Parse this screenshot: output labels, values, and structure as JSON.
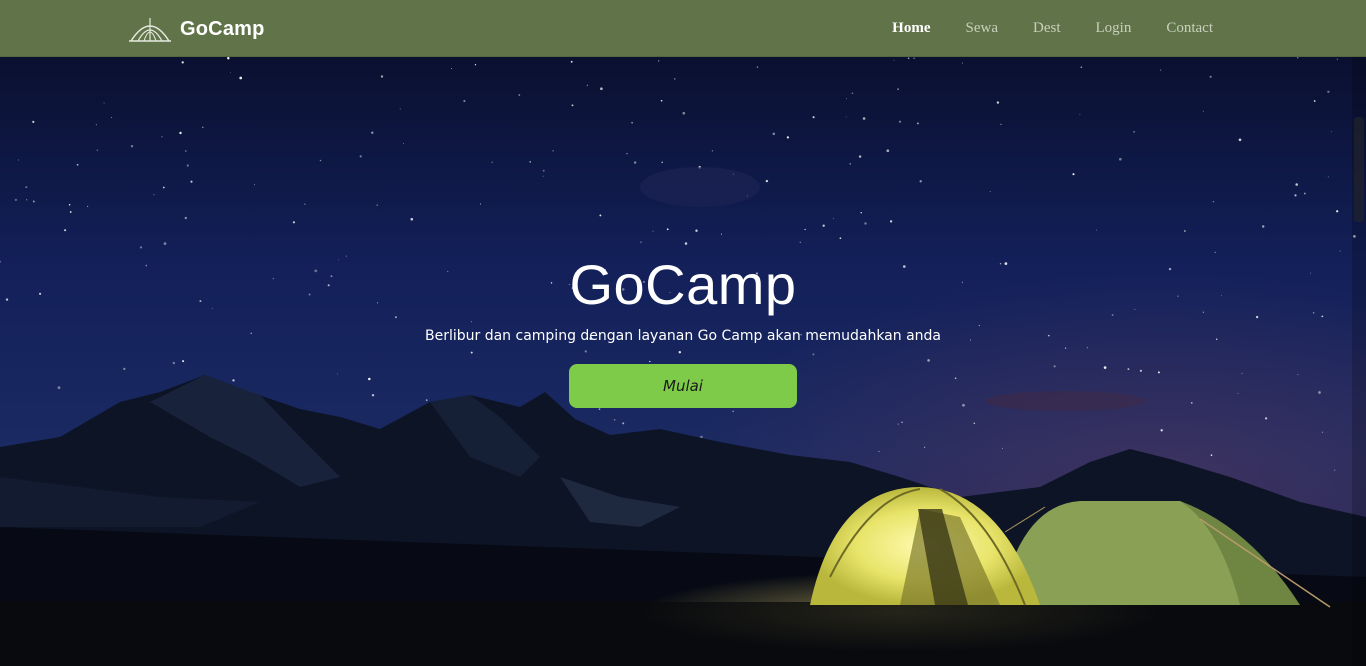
{
  "navbar": {
    "brand": "GoCamp",
    "brand_icon": "tent-icon",
    "links": [
      {
        "label": "Home",
        "active": true
      },
      {
        "label": "Sewa",
        "active": false
      },
      {
        "label": "Dest",
        "active": false
      },
      {
        "label": "Login",
        "active": false
      },
      {
        "label": "Contact",
        "active": false
      }
    ],
    "background_color": "#617349"
  },
  "hero": {
    "title": "GoCamp",
    "subtitle": "Berlibur dan camping dengan layanan Go Camp akan memudahkan anda",
    "cta_label": "Mulai",
    "cta_color": "#7ecb49"
  }
}
